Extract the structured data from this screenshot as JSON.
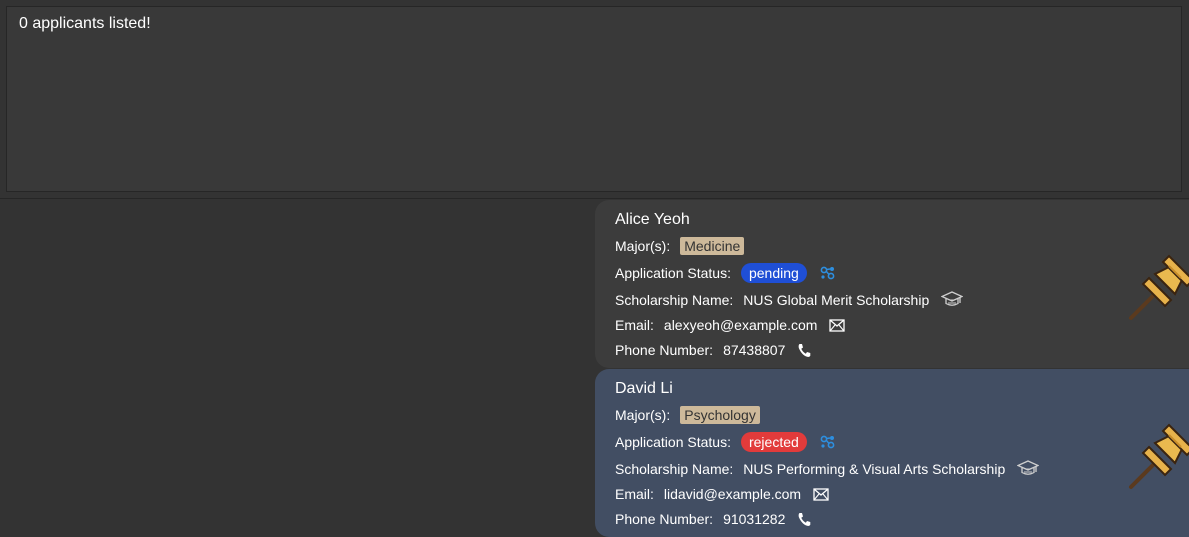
{
  "result": {
    "message": "0 applicants listed!"
  },
  "applicants": [
    {
      "name": "Alice Yeoh",
      "major_label": "Major(s):",
      "major": "Medicine",
      "status_label": "Application Status:",
      "status": "pending",
      "status_color": "#1f4fd6",
      "scholarship_label": "Scholarship Name:",
      "scholarship": "NUS Global Merit Scholarship",
      "email_label": "Email:",
      "email": "alexyeoh@example.com",
      "phone_label": "Phone Number:",
      "phone": "87438807"
    },
    {
      "name": "David Li",
      "major_label": "Major(s):",
      "major": "Psychology",
      "status_label": "Application Status:",
      "status": "rejected",
      "status_color": "#e23b3b",
      "scholarship_label": "Scholarship Name:",
      "scholarship": "NUS Performing & Visual Arts Scholarship",
      "email_label": "Email:",
      "email": "lidavid@example.com",
      "phone_label": "Phone Number:",
      "phone": "91031282"
    }
  ],
  "icons": {
    "status": "status-network-icon",
    "scholarship": "graduation-cap-icon",
    "email": "envelope-icon",
    "phone": "phone-icon",
    "pin": "pushpin-icon"
  },
  "colors": {
    "background": "#333333",
    "card_default": "#3c3c3c",
    "card_selected": "#424e63",
    "major_chip": "#cdb99a"
  }
}
